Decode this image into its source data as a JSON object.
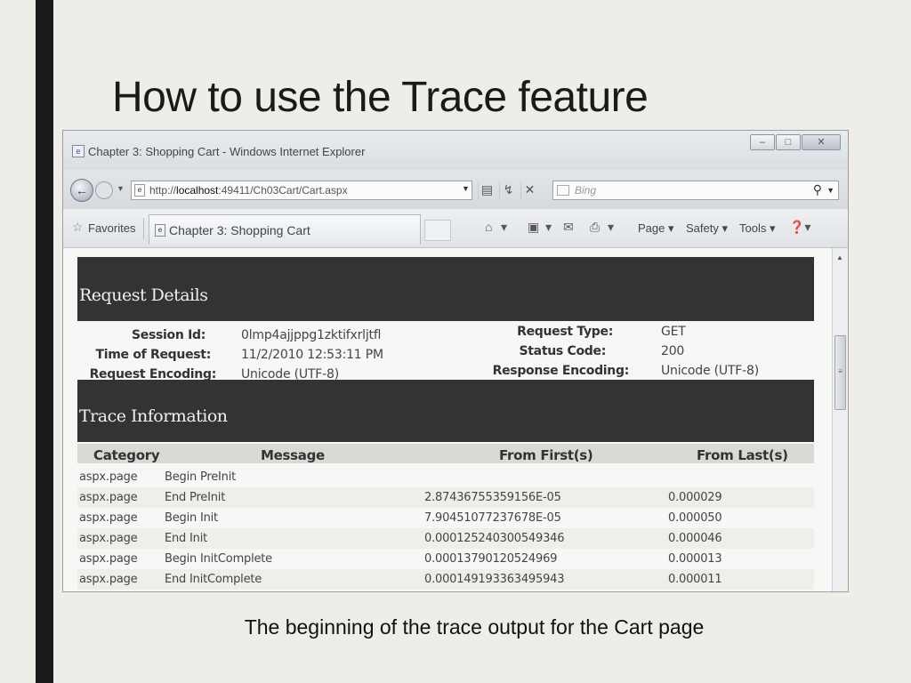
{
  "slide": {
    "title": "How to use the Trace feature",
    "caption": "The beginning of the trace output for the Cart page"
  },
  "browser": {
    "window_title": "Chapter 3: Shopping Cart - Windows Internet Explorer",
    "url_prefix": "http://",
    "url_host": "localhost",
    "url_rest": ":49411/Ch03Cart/Cart.aspx",
    "search_placeholder": "Bing",
    "favorites_label": "Favorites",
    "tab_label": "Chapter 3: Shopping Cart",
    "commands": {
      "page": "Page",
      "safety": "Safety",
      "tools": "Tools"
    }
  },
  "request_details": {
    "heading": "Request Details",
    "fields": [
      {
        "label": "Session Id:",
        "value": "0lmp4ajjppg1zktifxrljtfl"
      },
      {
        "label": "Time of Request:",
        "value": "11/2/2010 12:53:11 PM"
      },
      {
        "label": "Request Encoding:",
        "value": "Unicode (UTF-8)"
      },
      {
        "label": "Request Type:",
        "value": "GET"
      },
      {
        "label": "Status Code:",
        "value": "200"
      },
      {
        "label": "Response Encoding:",
        "value": "Unicode (UTF-8)"
      }
    ]
  },
  "trace_information": {
    "heading": "Trace Information",
    "columns": [
      "Category",
      "Message",
      "From First(s)",
      "From Last(s)"
    ],
    "rows": [
      {
        "category": "aspx.page",
        "message": "Begin PreInit",
        "from_first": "",
        "from_last": ""
      },
      {
        "category": "aspx.page",
        "message": "End PreInit",
        "from_first": "2.87436755359156E-05",
        "from_last": "0.000029"
      },
      {
        "category": "aspx.page",
        "message": "Begin Init",
        "from_first": "7.90451077237678E-05",
        "from_last": "0.000050"
      },
      {
        "category": "aspx.page",
        "message": "End Init",
        "from_first": "0.000125240300549346",
        "from_last": "0.000046"
      },
      {
        "category": "aspx.page",
        "message": "Begin InitComplete",
        "from_first": "0.00013790120524969",
        "from_last": "0.000013"
      },
      {
        "category": "aspx.page",
        "message": "End InitComplete",
        "from_first": "0.000149193363495943",
        "from_last": "0.000011"
      }
    ]
  }
}
